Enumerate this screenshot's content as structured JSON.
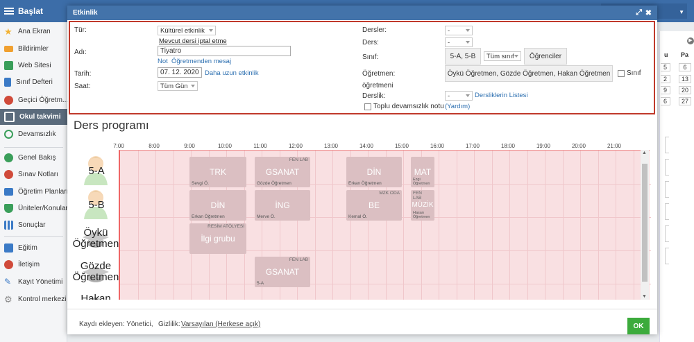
{
  "app": {
    "title": "Başlat"
  },
  "sidebar": {
    "items": [
      {
        "label": "Ana Ekran",
        "icon": "star-icon",
        "color": "#f2b233"
      },
      {
        "label": "Bildirimler",
        "icon": "envelope-icon",
        "color": "#f0a030"
      },
      {
        "label": "Web Sitesi",
        "icon": "home-icon",
        "color": "#3a9e5a"
      },
      {
        "label": "Sınıf Defteri",
        "icon": "notebook-icon",
        "color": "#3b7ac6"
      },
      {
        "label": "Geçici Öğretm...",
        "icon": "person-icon",
        "color": "#d04a3a"
      },
      {
        "label": "Okul takvimi",
        "icon": "calendar-icon",
        "color": "#ffffff"
      },
      {
        "label": "Devamsızlık",
        "icon": "person-outline-icon",
        "color": "#3a9e5a"
      },
      {
        "label": "Genel Bakış",
        "icon": "check-circle-icon",
        "color": "#3a9e5a"
      },
      {
        "label": "Sınav Notları",
        "icon": "gauge-icon",
        "color": "#d04a3a"
      },
      {
        "label": "Öğretim Planları",
        "icon": "briefcase-icon",
        "color": "#3b7ac6"
      },
      {
        "label": "Üniteler/Konular",
        "icon": "shield-icon",
        "color": "#3a9e5a"
      },
      {
        "label": "Sonuçlar",
        "icon": "bar-chart-icon",
        "color": "#3b7ac6"
      },
      {
        "label": "Eğitim",
        "icon": "building-icon",
        "color": "#3b7ac6"
      },
      {
        "label": "İletişim",
        "icon": "chat-icon",
        "color": "#d04a3a"
      },
      {
        "label": "Kayıt Yönetimi",
        "icon": "pen-icon",
        "color": "#3b7ac6"
      },
      {
        "label": "Kontrol merkezi",
        "icon": "gear-icon",
        "color": "#888888"
      }
    ]
  },
  "minical": {
    "headers": [
      "u",
      "Pa"
    ],
    "rows": [
      [
        "5",
        "6"
      ],
      [
        "2",
        "13"
      ],
      [
        "9",
        "20"
      ],
      [
        "6",
        "27"
      ]
    ]
  },
  "modal": {
    "title": "Etkinlik",
    "expand_icon": "⤢",
    "close_icon": "✖",
    "tur": {
      "label": "Tür:",
      "value": "Kültürel etkinlik"
    },
    "cancel_link": "Mevcut dersi iptal etme",
    "adi": {
      "label": "Adı:",
      "value": "Tiyatro"
    },
    "note_link": "Not",
    "teacher_msg_link": "Öğretmenden mesaj",
    "tarih": {
      "label": "Tarih:",
      "value": "07. 12. 2020",
      "longer_link": "Daha uzun etkinlik"
    },
    "saat": {
      "label": "Saat:",
      "value": "Tüm Gün"
    },
    "dersler": {
      "label": "Dersler:",
      "value": "-"
    },
    "ders": {
      "label": "Ders:",
      "value": "-"
    },
    "sinif": {
      "label": "Sınıf:",
      "value": "5-A, 5-B",
      "all_value": "Tüm sınıf",
      "students_button": "Öğrenciler"
    },
    "ogretmen": {
      "label": "Öğretmen:",
      "value": "Öykü Öğretmen, Gözde Öğretmen, Hakan Öğretmen",
      "checkbox_label": "Sınıf",
      "checkbox_label2": "öğretmeni"
    },
    "derslik": {
      "label": "Derslik:",
      "value": "-",
      "list_link": "Dersliklerin Listesi"
    },
    "toplu": {
      "label": "Toplu devamsızlık notu",
      "help_link": "(Yardım)"
    },
    "section_title": "Ders programı",
    "time_labels": [
      "7:00",
      "8:00",
      "9:00",
      "10:00",
      "11:00",
      "12:00",
      "13:00",
      "14:00",
      "15:00",
      "16:00",
      "17:00",
      "18:00",
      "19:00",
      "20:00",
      "21:00"
    ],
    "rows": [
      {
        "name": "5-A"
      },
      {
        "name": "5-B"
      },
      {
        "name": "Öykü Öğretmen"
      },
      {
        "name": "Gözde Öğretmen"
      },
      {
        "name": "Hakan Öğretmen"
      }
    ],
    "lessons": [
      {
        "subject": "TRK",
        "room": "",
        "teacher": "Sevgi Ö."
      },
      {
        "subject": "GSANAT",
        "room": "FEN LAB",
        "teacher": "Gözde Öğretmen"
      },
      {
        "subject": "DİN",
        "room": "",
        "teacher": "Erkan Öğretmen"
      },
      {
        "subject": "MAT",
        "room": "",
        "teacher": "Ezgi Öğretmen"
      },
      {
        "subject": "DİN",
        "room": "",
        "teacher": "Erkan Öğretmen"
      },
      {
        "subject": "İNG",
        "room": "",
        "teacher": "Merve Ö."
      },
      {
        "subject": "BE",
        "room": "MZK ODA",
        "teacher": "Kemal Ö."
      },
      {
        "subject": "MÜZİK",
        "room": "FEN LAB",
        "teacher": "Hasan Öğretmen"
      },
      {
        "subject": "İlgi grubu",
        "room": "RESİM ATÖLYESİ",
        "teacher": ""
      },
      {
        "subject": "GSANAT",
        "room": "FEN LAB",
        "teacher": "5-A"
      }
    ],
    "footer": {
      "added_by": "Kaydı ekleyen: Yönetici,",
      "privacy_label": "Gizlilik:",
      "privacy_value": "Varsayılan (Herkese açık)",
      "ok": "OK"
    }
  }
}
